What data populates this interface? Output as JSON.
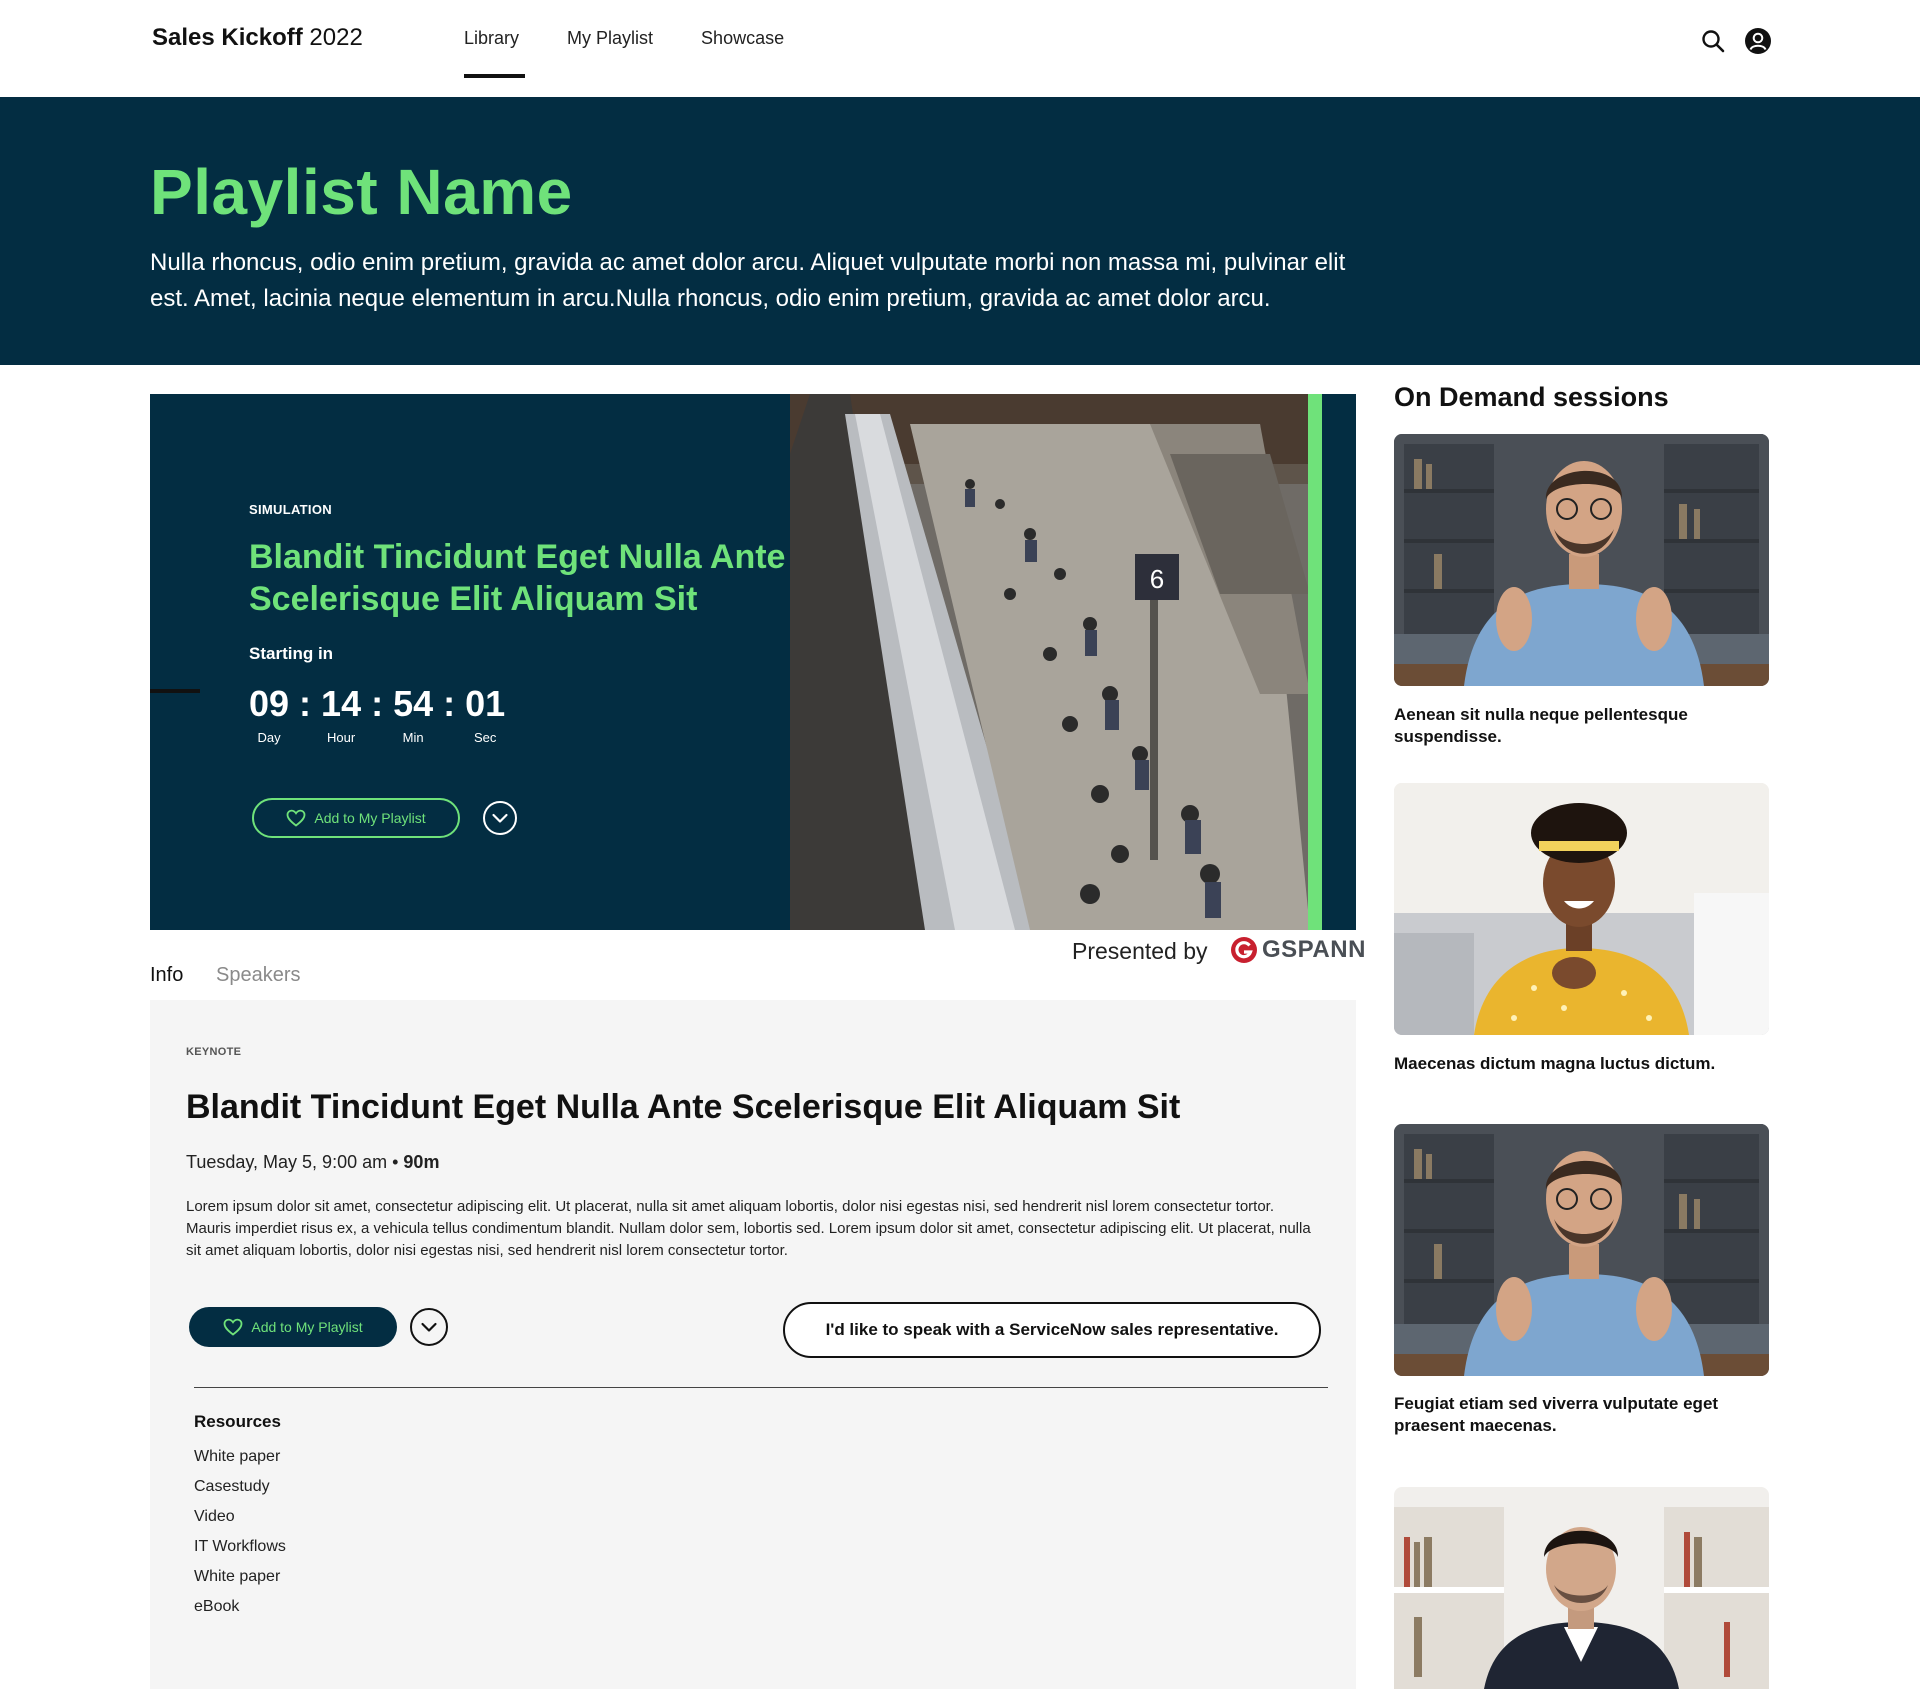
{
  "header": {
    "brand_bold": "Sales Kickoff",
    "brand_light": "2022",
    "nav": [
      {
        "label": "Library",
        "active": true
      },
      {
        "label": "My Playlist",
        "active": false
      },
      {
        "label": "Showcase",
        "active": false
      }
    ],
    "icons": [
      "search-icon",
      "user-account-icon"
    ]
  },
  "hero": {
    "title": "Playlist Name",
    "description": "Nulla rhoncus, odio enim pretium, gravida ac amet dolor arcu. Aliquet vulputate morbi non massa mi, pulvinar elit est. Amet, lacinia neque elementum in arcu.Nulla rhoncus, odio enim pretium, gravida ac amet dolor arcu."
  },
  "feature": {
    "eyebrow": "SIMULATION",
    "title": "Blandit Tincidunt Eget Nulla Ante Scelerisque Elit Aliquam Sit",
    "starting_label": "Starting in",
    "countdown": [
      {
        "value": "09",
        "label": "Day"
      },
      {
        "value": "14",
        "label": "Hour"
      },
      {
        "value": "54",
        "label": "Min"
      },
      {
        "value": "01",
        "label": "Sec"
      }
    ],
    "add_label": "Add to My Playlist",
    "platform_number": "6",
    "presented_by": "Presented by",
    "sponsor": "GSPANN"
  },
  "tabs": [
    {
      "label": "Info",
      "active": true
    },
    {
      "label": "Speakers",
      "active": false
    }
  ],
  "info": {
    "eyebrow": "KEYNOTE",
    "title": "Blandit Tincidunt Eget Nulla Ante Scelerisque Elit Aliquam Sit",
    "date": "Tuesday, May 5, 9:00 am •",
    "duration": "90m",
    "body": "Lorem ipsum dolor sit amet, consectetur adipiscing elit. Ut placerat, nulla sit amet aliquam lobortis, dolor nisi egestas nisi, sed hendrerit nisl lorem consectetur tortor. Mauris imperdiet risus ex, a vehicula tellus condimentum blandit. Nullam dolor sem, lobortis sed. Lorem ipsum dolor sit amet, consectetur adipiscing elit. Ut placerat, nulla sit amet aliquam lobortis, dolor nisi egestas nisi, sed hendrerit nisl lorem consectetur tortor.",
    "add_label": "Add to My Playlist",
    "speak_label": "I'd like to speak with a ServiceNow sales representative.",
    "resources_title": "Resources",
    "resources": [
      "White paper",
      "Casestudy",
      "Video",
      "IT Workflows",
      "White paper",
      "eBook"
    ]
  },
  "sidebar": {
    "title": "On Demand sessions",
    "sessions": [
      {
        "caption": "Aenean sit nulla neque pellentesque suspendisse."
      },
      {
        "caption": "Maecenas dictum magna luctus dictum."
      },
      {
        "caption": "Feugiat etiam sed viverra vulputate eget praesent maecenas."
      },
      {
        "caption": ""
      }
    ]
  },
  "colors": {
    "navy": "#032d42",
    "green": "#6fe27a",
    "panel": "#f5f5f5",
    "sponsor_red": "#c8202f"
  }
}
